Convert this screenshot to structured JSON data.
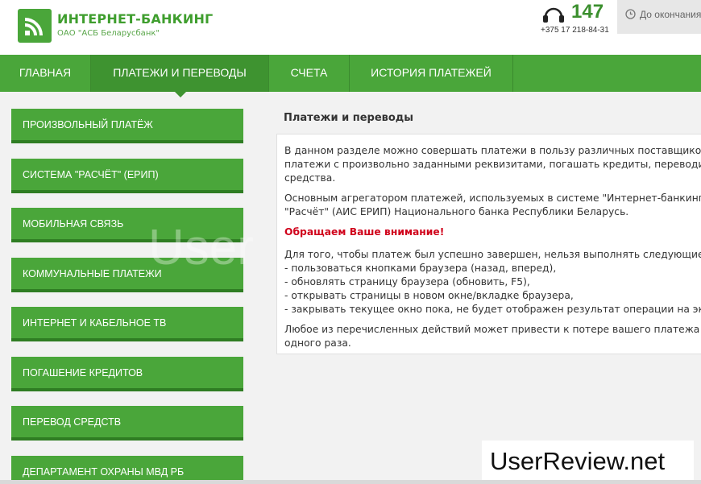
{
  "header": {
    "brand_title": "ИНТЕРНЕТ-БАНКИНГ",
    "brand_subtitle": "ОАО \"АСБ Беларусбанк\"",
    "logo_icon": "wifi-bank-logo-icon",
    "phone_short": "147",
    "phone_full": "+375 17 218-84-31",
    "phone_icon": "headset-icon",
    "session_text": "До окончания",
    "session_icon": "clock-icon"
  },
  "nav": {
    "items": [
      {
        "label": "ГЛАВНАЯ"
      },
      {
        "label": "ПЛАТЕЖИ И ПЕРЕВОДЫ"
      },
      {
        "label": "СЧЕТА"
      },
      {
        "label": "ИСТОРИЯ ПЛАТЕЖЕЙ"
      }
    ]
  },
  "sidebar": {
    "items": [
      {
        "label": "ПРОИЗВОЛЬНЫЙ ПЛАТЁЖ"
      },
      {
        "label": "СИСТЕМА \"РАСЧЁТ\" (ЕРИП)"
      },
      {
        "label": "МОБИЛЬНАЯ СВЯЗЬ"
      },
      {
        "label": "КОММУНАЛЬНЫЕ ПЛАТЕЖИ"
      },
      {
        "label": "ИНТЕРНЕТ И КАБЕЛЬНОЕ ТВ"
      },
      {
        "label": "ПОГАШЕНИЕ КРЕДИТОВ"
      },
      {
        "label": "ПЕРЕВОД СРЕДСТВ"
      },
      {
        "label": "ДЕПАРТАМЕНТ ОХРАНЫ МВД РБ"
      }
    ]
  },
  "content": {
    "title": "Платежи и переводы",
    "p1": [
      "В данном разделе можно совершать платежи в пользу различных поставщиков",
      "платежи с произвольно заданными реквизитами, погашать кредиты, переводит",
      "средства."
    ],
    "p2": [
      "Основным агрегатором платежей, используемых в системе \"Интернет-банкинг\"",
      "\"Расчёт\" (АИС ЕРИП) Национального банка Республики Беларусь."
    ],
    "alert": "Обращаем Ваше внимание!",
    "p3": [
      "Для того, чтобы платеж был успешно завершен, нельзя выполнять следующие",
      "- пользоваться кнопками браузера (назад, вперед),",
      "- обновлять страницу браузера (обновить, F5),",
      "- открывать страницы в новом окне/вкладке браузера,",
      "- закрывать текущее окно пока, не будет отображен результат операции на эк"
    ],
    "p4": [
      "Любое из перечисленных действий может привести к потере вашего платежа и",
      "одного раза."
    ]
  },
  "watermark": {
    "ghost": "User",
    "label": "UserReview.net"
  },
  "colors": {
    "brand_green": "#4aa63a",
    "active_green": "#3e9330",
    "alert_red": "#d0021b"
  }
}
